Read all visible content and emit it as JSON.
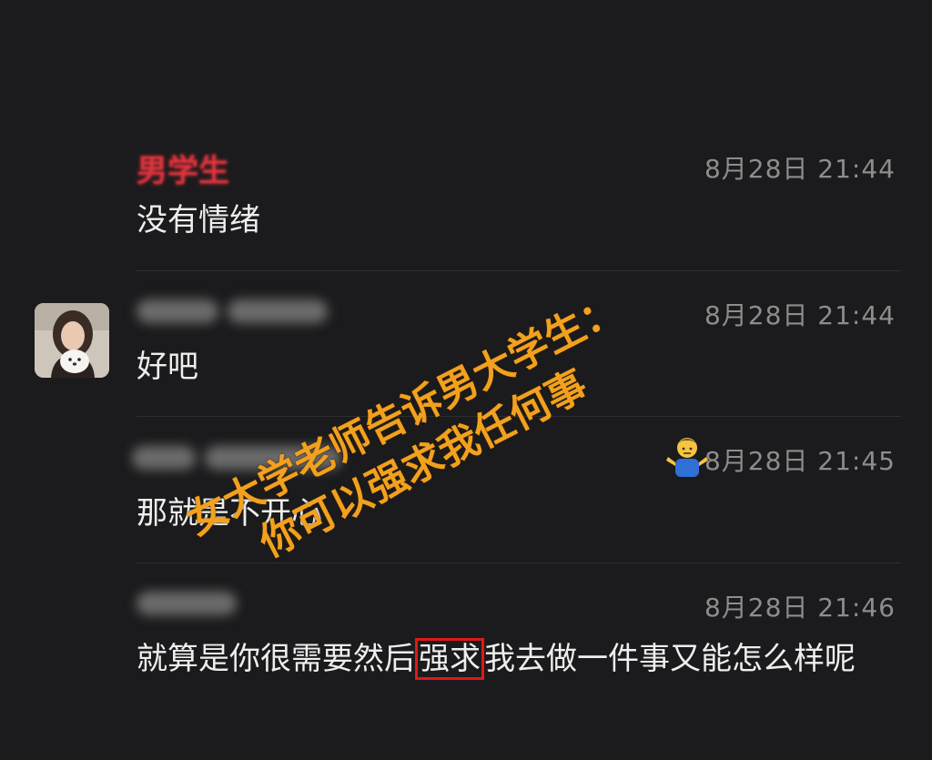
{
  "messages": [
    {
      "sender": "男学生",
      "time": "8月28日 21:44",
      "text": "没有情绪"
    },
    {
      "sender": "",
      "time": "8月28日 21:44",
      "text": "好吧"
    },
    {
      "sender": "",
      "time": "8月28日 21:45",
      "text": "那就是不开心"
    },
    {
      "sender": "",
      "time": "8月28日 21:46",
      "text_before": "就算是你很需要然后",
      "text_highlight": "强求",
      "text_after": "我去做一件事又能怎么样呢"
    }
  ],
  "overlay": {
    "line1": "女大学老师告诉男大学生：",
    "line2": "你可以强求我任何事"
  },
  "colors": {
    "background": "#1b1b1d",
    "overlay_text": "#f2a11e",
    "highlight_box": "#e01818",
    "sender_red": "#e0343d"
  },
  "icons": {
    "emoji": "person-shrugging-icon",
    "avatar": "profile-avatar"
  }
}
